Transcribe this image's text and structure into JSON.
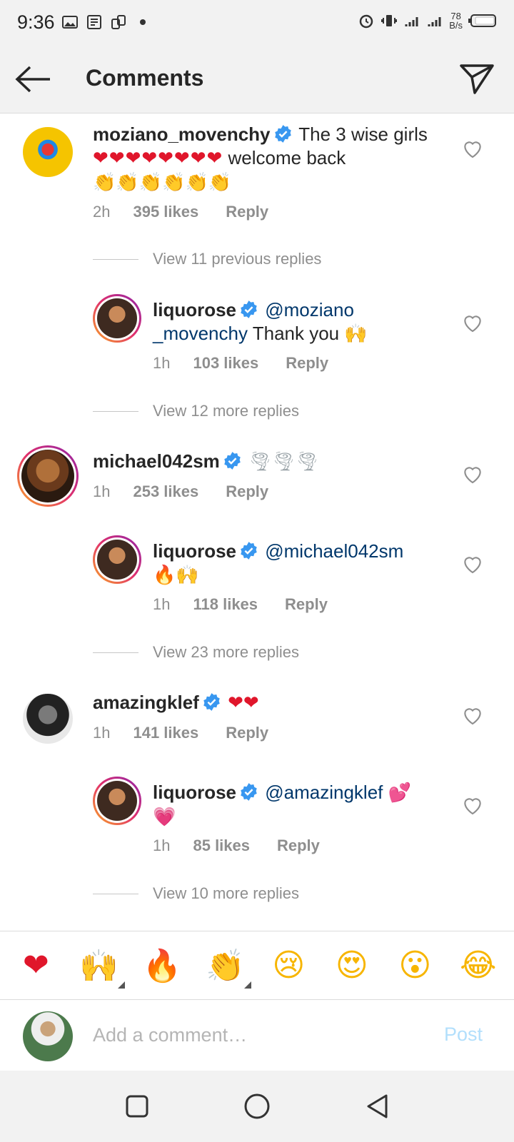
{
  "status_bar": {
    "time": "9:36",
    "net_speed_value": "78",
    "net_speed_unit": "B/s",
    "network": "3G"
  },
  "header": {
    "title": "Comments"
  },
  "comments": [
    {
      "username": "moziano_movenchy",
      "text_line1": "The 3 wise girls",
      "text_line2_emoji": "❤❤❤❤❤❤❤❤",
      "text_line2": "welcome back",
      "text_line3_emoji": "👏👏👏👏👏👏",
      "time": "2h",
      "likes": "395 likes",
      "reply": "Reply"
    },
    {
      "view_replies": "View 11 previous replies"
    },
    {
      "username": "liquorose",
      "mention_part1": "@moziano",
      "mention_part2": "_movenchy",
      "text": "Thank you",
      "emoji": "🙌",
      "time": "1h",
      "likes": "103 likes",
      "reply": "Reply"
    },
    {
      "view_replies": "View 12 more replies"
    },
    {
      "username": "michael042sm",
      "emoji": "🌪🌪🌪",
      "time": "1h",
      "likes": "253 likes",
      "reply": "Reply"
    },
    {
      "username": "liquorose",
      "mention": "@michael042sm",
      "emoji": "🔥🙌",
      "time": "1h",
      "likes": "118 likes",
      "reply": "Reply"
    },
    {
      "view_replies": "View 23 more replies"
    },
    {
      "username": "amazingklef",
      "emoji": "❤❤",
      "time": "1h",
      "likes": "141 likes",
      "reply": "Reply"
    },
    {
      "username": "liquorose",
      "mention": "@amazingklef",
      "emoji1": "💕",
      "emoji2": "💗",
      "time": "1h",
      "likes": "85 likes",
      "reply": "Reply"
    },
    {
      "view_replies": "View 10 more replies"
    }
  ],
  "emoji_bar": [
    "❤",
    "🙌",
    "🔥",
    "👏",
    "😢",
    "😍",
    "😮",
    "😂"
  ],
  "add_comment": {
    "placeholder": "Add a comment…",
    "post_label": "Post"
  },
  "colors": {
    "verified": "#3897f0",
    "mention": "#00376b",
    "meta": "#8e8e8e",
    "post_disabled": "#b2dffc"
  }
}
